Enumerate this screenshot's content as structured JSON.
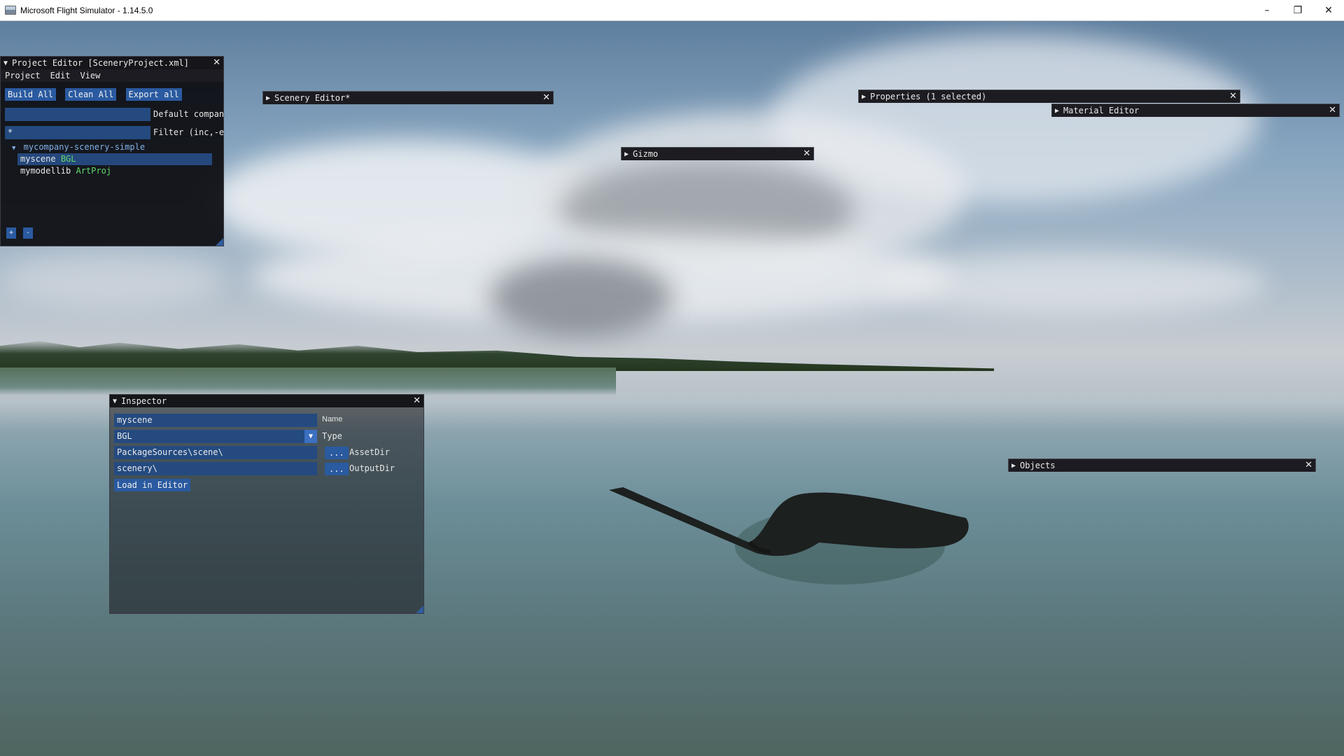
{
  "window": {
    "title": "Microsoft Flight Simulator - 1.14.5.0",
    "controls": [
      "–",
      "❐",
      "✕"
    ]
  },
  "project_editor": {
    "title": "Project Editor [SceneryProject.xml]",
    "menu": [
      "Project",
      "Edit",
      "View"
    ],
    "buttons": [
      "Build All",
      "Clean All",
      "Export all"
    ],
    "company_value": "",
    "company_label": "Default compan",
    "filter_value": "*",
    "filter_label": "Filter (inc,-e",
    "tree_root": "mycompany-scenery-simple",
    "items": [
      {
        "name": "myscene",
        "type": "BGL"
      },
      {
        "name": "mymodellib",
        "type": "ArtProj"
      }
    ],
    "add_label": "+",
    "remove_label": "-"
  },
  "scenery_editor": {
    "title": "Scenery Editor*"
  },
  "gizmo": {
    "title": "Gizmo"
  },
  "properties": {
    "title": "Properties (1 selected)"
  },
  "material_editor": {
    "title": "Material Editor"
  },
  "objects": {
    "title": "Objects"
  },
  "inspector": {
    "title": "Inspector",
    "name_value": "myscene",
    "name_label": "Name",
    "type_value": "BGL",
    "type_label": "Type",
    "asset_dir_value": "PackageSources\\scene\\",
    "asset_dir_label": "AssetDir",
    "output_dir_value": "scenery\\",
    "output_dir_label": "OutputDir",
    "browse_label": "...",
    "load_button": "Load in Editor"
  },
  "colors": {
    "accent": "#2a5aa0",
    "tag_green": "#5fd96b",
    "link_blue": "#7fb0e8"
  }
}
